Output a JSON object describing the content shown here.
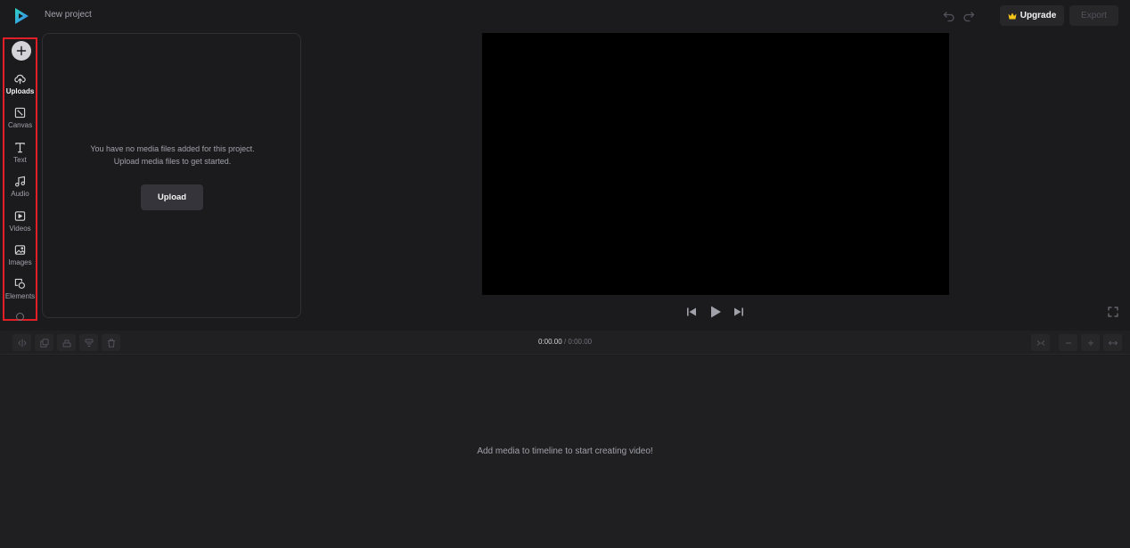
{
  "header": {
    "project_title": "New project",
    "upgrade_label": "Upgrade",
    "export_label": "Export"
  },
  "sidebar": {
    "items": [
      {
        "label": "Uploads",
        "icon": "cloud-upload-icon",
        "active": true
      },
      {
        "label": "Canvas",
        "icon": "canvas-icon"
      },
      {
        "label": "Text",
        "icon": "text-icon"
      },
      {
        "label": "Audio",
        "icon": "music-note-icon"
      },
      {
        "label": "Videos",
        "icon": "video-icon"
      },
      {
        "label": "Images",
        "icon": "image-icon"
      },
      {
        "label": "Elements",
        "icon": "shapes-icon"
      }
    ]
  },
  "media_panel": {
    "message_line1": "You have no media files added for this project.",
    "message_line2": "Upload media files to get started.",
    "upload_label": "Upload"
  },
  "timeline": {
    "current_time": "0:00.00",
    "separator": "/",
    "total_time": "0:00.00",
    "empty_message": "Add media to timeline to start creating video!"
  },
  "colors": {
    "background": "#1b1b1e",
    "sidebar_highlight": "#e21f26",
    "preview_bg": "#000000",
    "upgrade_crown": "#f5c518"
  }
}
